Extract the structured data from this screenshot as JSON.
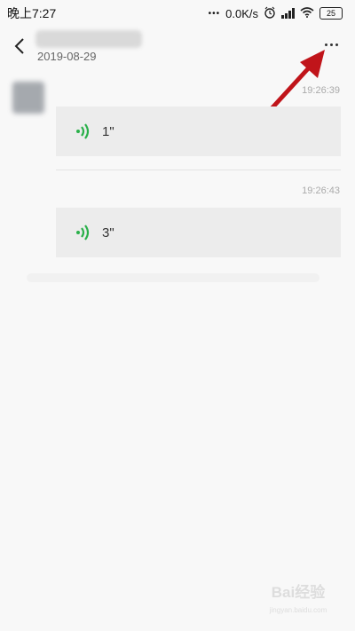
{
  "status_bar": {
    "time": "晚上7:27",
    "network_speed": "0.0K/s",
    "battery": "25"
  },
  "header": {
    "date": "2019-08-29"
  },
  "messages": [
    {
      "timestamp": "19:26:39",
      "duration": "1\""
    },
    {
      "timestamp": "19:26:43",
      "duration": "3\""
    }
  ],
  "colors": {
    "voice_icon": "#2ab04a",
    "arrow": "#c0141a"
  },
  "watermark": {
    "text": "Bai经验",
    "sub": "jingyan.baidu.com"
  }
}
